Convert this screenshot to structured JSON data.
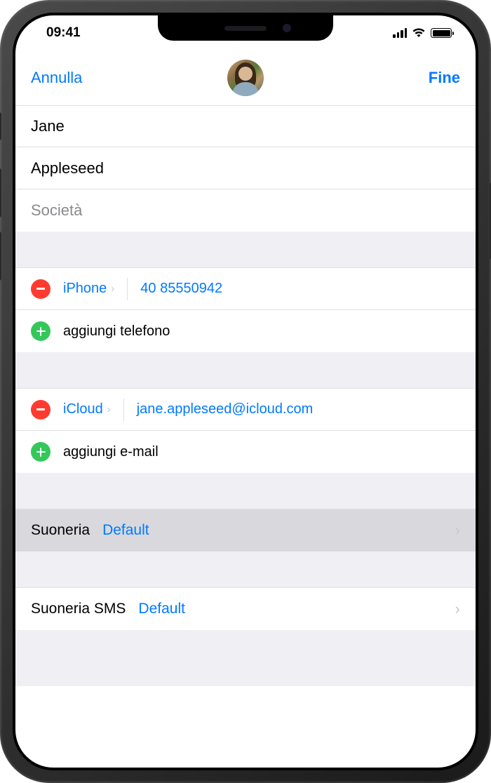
{
  "status": {
    "time": "09:41"
  },
  "nav": {
    "cancel": "Annulla",
    "done": "Fine"
  },
  "name": {
    "first": "Jane",
    "last": "Appleseed",
    "company_placeholder": "Società"
  },
  "phone": {
    "type_label": "iPhone",
    "number": "40 85550942",
    "add_label": "aggiungi telefono"
  },
  "email": {
    "type_label": "iCloud",
    "address": "jane.appleseed@icloud.com",
    "add_label": "aggiungi e-mail"
  },
  "ringtone": {
    "label": "Suoneria",
    "value": "Default"
  },
  "texttone": {
    "label": "Suoneria SMS",
    "value": "Default"
  }
}
